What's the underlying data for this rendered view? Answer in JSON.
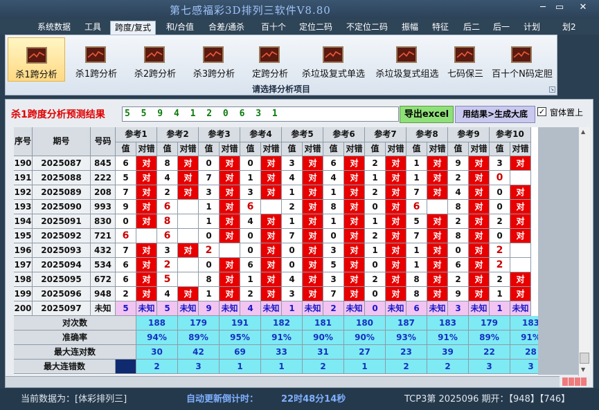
{
  "app": {
    "title": "第七感福彩3D排列三软件V8.80",
    "win_min": "─",
    "win_max": "▭",
    "win_close": "✕"
  },
  "menu": [
    {
      "label": "系统数据",
      "active": false
    },
    {
      "label": "工具",
      "active": false
    },
    {
      "label": "跨度/复式",
      "active": true
    },
    {
      "label": "和/合值",
      "active": false
    },
    {
      "label": "合差/通杀",
      "active": false
    },
    {
      "label": "百十个",
      "active": false
    },
    {
      "label": "定位二码",
      "active": false
    },
    {
      "label": "不定位二码",
      "active": false
    },
    {
      "label": "振幅",
      "active": false
    },
    {
      "label": "特征",
      "active": false
    },
    {
      "label": "后二",
      "active": false
    },
    {
      "label": "后一",
      "active": false
    },
    {
      "label": "计划",
      "active": false
    },
    {
      "label": "划2",
      "active": false
    }
  ],
  "ribbon": {
    "buttons": [
      {
        "label": "杀1跨分析",
        "icon": "chart-icon",
        "selected": true
      },
      {
        "label": "杀1跨分析",
        "icon": "chart-icon",
        "selected": false
      },
      {
        "label": "杀2跨分析",
        "icon": "chart-icon",
        "selected": false
      },
      {
        "label": "杀3跨分析",
        "icon": "chart-icon",
        "selected": false
      },
      {
        "label": "定跨分析",
        "icon": "chart-icon",
        "selected": false
      },
      {
        "label": "杀垃圾复式单选",
        "icon": "chart-icon",
        "selected": false
      },
      {
        "label": "杀垃圾复式组选",
        "icon": "chart-icon",
        "selected": false
      },
      {
        "label": "七码保三",
        "icon": "chart-icon",
        "selected": false
      },
      {
        "label": "百十个N码定胆",
        "icon": "chart-icon",
        "selected": false
      }
    ],
    "caption": "请选择分析项目"
  },
  "result": {
    "label": "杀1跨度分析预测结果",
    "value": "5 5 9 4 1 2 0 6 3 1",
    "excel_button": "导出excel",
    "gen_button": "用结果>生成大底",
    "topmost_checkbox": "窗体置上",
    "topmost_checked": true
  },
  "table": {
    "headers": {
      "seq": "序号",
      "period": "期号",
      "number": "号码",
      "value": "值",
      "check": "对错",
      "refs": [
        "参考1",
        "参考2",
        "参考3",
        "参考4",
        "参考5",
        "参考6",
        "参考7",
        "参考8",
        "参考9",
        "参考10"
      ]
    },
    "rows": [
      {
        "seq": "190",
        "period": "2025087",
        "num": "845",
        "cells": [
          [
            "6",
            "对"
          ],
          [
            "8",
            "对"
          ],
          [
            "0",
            "对"
          ],
          [
            "0",
            "对"
          ],
          [
            "3",
            "对"
          ],
          [
            "6",
            "对"
          ],
          [
            "2",
            "对"
          ],
          [
            "1",
            "对"
          ],
          [
            "9",
            "对"
          ],
          [
            "3",
            "对"
          ]
        ]
      },
      {
        "seq": "191",
        "period": "2025088",
        "num": "222",
        "cells": [
          [
            "5",
            "对"
          ],
          [
            "4",
            "对"
          ],
          [
            "7",
            "对"
          ],
          [
            "1",
            "对"
          ],
          [
            "4",
            "对"
          ],
          [
            "4",
            "对"
          ],
          [
            "1",
            "对"
          ],
          [
            "1",
            "对"
          ],
          [
            "2",
            "对"
          ],
          [
            "0r",
            ""
          ]
        ]
      },
      {
        "seq": "192",
        "period": "2025089",
        "num": "208",
        "cells": [
          [
            "7",
            "对"
          ],
          [
            "2",
            "对"
          ],
          [
            "3",
            "对"
          ],
          [
            "3",
            "对"
          ],
          [
            "1",
            "对"
          ],
          [
            "1",
            "对"
          ],
          [
            "2",
            "对"
          ],
          [
            "7",
            "对"
          ],
          [
            "4",
            "对"
          ],
          [
            "0",
            "对"
          ]
        ]
      },
      {
        "seq": "193",
        "period": "2025090",
        "num": "993",
        "cells": [
          [
            "9",
            "对"
          ],
          [
            "6r",
            ""
          ],
          [
            "1",
            "对"
          ],
          [
            "6r",
            ""
          ],
          [
            "2",
            "对"
          ],
          [
            "8",
            "对"
          ],
          [
            "0",
            "对"
          ],
          [
            "6r",
            ""
          ],
          [
            "8",
            "对"
          ],
          [
            "0",
            "对"
          ]
        ]
      },
      {
        "seq": "194",
        "period": "2025091",
        "num": "830",
        "cells": [
          [
            "0",
            "对"
          ],
          [
            "8r",
            ""
          ],
          [
            "1",
            "对"
          ],
          [
            "4",
            "对"
          ],
          [
            "1",
            "对"
          ],
          [
            "1",
            "对"
          ],
          [
            "1",
            "对"
          ],
          [
            "5",
            "对"
          ],
          [
            "2",
            "对"
          ],
          [
            "2",
            "对"
          ]
        ]
      },
      {
        "seq": "195",
        "period": "2025092",
        "num": "721",
        "cells": [
          [
            "6r",
            ""
          ],
          [
            "6r",
            ""
          ],
          [
            "0",
            "对"
          ],
          [
            "0",
            "对"
          ],
          [
            "7",
            "对"
          ],
          [
            "0",
            "对"
          ],
          [
            "2",
            "对"
          ],
          [
            "7",
            "对"
          ],
          [
            "8",
            "对"
          ],
          [
            "0",
            "对"
          ]
        ]
      },
      {
        "seq": "196",
        "period": "2025093",
        "num": "432",
        "cells": [
          [
            "7",
            "对"
          ],
          [
            "3",
            "对"
          ],
          [
            "2r",
            ""
          ],
          [
            "0",
            "对"
          ],
          [
            "0",
            "对"
          ],
          [
            "3",
            "对"
          ],
          [
            "1",
            "对"
          ],
          [
            "1",
            "对"
          ],
          [
            "0",
            "对"
          ],
          [
            "2r",
            ""
          ]
        ]
      },
      {
        "seq": "197",
        "period": "2025094",
        "num": "534",
        "cells": [
          [
            "6",
            "对"
          ],
          [
            "2r",
            ""
          ],
          [
            "0",
            "对"
          ],
          [
            "6",
            "对"
          ],
          [
            "0",
            "对"
          ],
          [
            "5",
            "对"
          ],
          [
            "0",
            "对"
          ],
          [
            "1",
            "对"
          ],
          [
            "6",
            "对"
          ],
          [
            "2r",
            ""
          ]
        ]
      },
      {
        "seq": "198",
        "period": "2025095",
        "num": "672",
        "cells": [
          [
            "6",
            "对"
          ],
          [
            "5r",
            ""
          ],
          [
            "8",
            "对"
          ],
          [
            "1",
            "对"
          ],
          [
            "4",
            "对"
          ],
          [
            "3",
            "对"
          ],
          [
            "2",
            "对"
          ],
          [
            "8",
            "对"
          ],
          [
            "2",
            "对"
          ],
          [
            "2",
            "对"
          ]
        ]
      },
      {
        "seq": "199",
        "period": "2025096",
        "num": "948",
        "cells": [
          [
            "2",
            "对"
          ],
          [
            "4",
            "对"
          ],
          [
            "1",
            "对"
          ],
          [
            "2",
            "对"
          ],
          [
            "3",
            "对"
          ],
          [
            "7",
            "对"
          ],
          [
            "0",
            "对"
          ],
          [
            "8",
            "对"
          ],
          [
            "9",
            "对"
          ],
          [
            "1",
            "对"
          ]
        ]
      }
    ],
    "next_row": {
      "seq": "200",
      "period": "2025097",
      "num": "未知",
      "values": [
        "5",
        "5",
        "9",
        "4",
        "1",
        "2",
        "0",
        "6",
        "3",
        "1"
      ],
      "status": "未知"
    },
    "stats": [
      {
        "label": "对次数",
        "values": [
          "188",
          "179",
          "191",
          "182",
          "181",
          "180",
          "187",
          "183",
          "179",
          "183"
        ]
      },
      {
        "label": "准确率",
        "values": [
          "94%",
          "89%",
          "95%",
          "91%",
          "90%",
          "90%",
          "93%",
          "91%",
          "89%",
          "91%"
        ]
      },
      {
        "label": "最大连对数",
        "values": [
          "30",
          "42",
          "69",
          "33",
          "31",
          "27",
          "23",
          "39",
          "22",
          "28"
        ]
      },
      {
        "label": "最大连错数",
        "values": [
          "2",
          "3",
          "1",
          "1",
          "2",
          "1",
          "2",
          "2",
          "3",
          "3"
        ]
      }
    ]
  },
  "status": {
    "current": "当前数据为：[体彩排列三]",
    "countdown_label": "自动更新倒计时：",
    "countdown": "22时48分14秒",
    "tcp": "TCP3第 2025096 期开：【948】【746】"
  },
  "colors": {
    "hit": "#e80000",
    "miss_text": "#cc0000",
    "stats_bg": "#7eeaf4",
    "unknown_bg": "#f2c4f2"
  }
}
